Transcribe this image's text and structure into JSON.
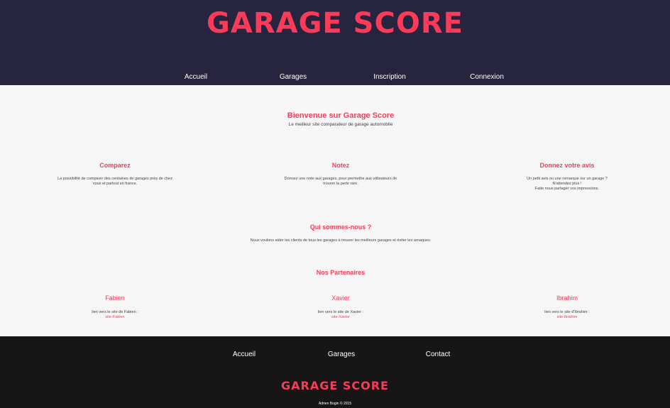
{
  "site": {
    "logo": "GARAGE SCORE"
  },
  "nav": [
    {
      "label": "Accueil"
    },
    {
      "label": "Garages"
    },
    {
      "label": "Inscription"
    },
    {
      "label": "Connexion"
    }
  ],
  "welcome": {
    "title": "Bienvenue sur Garage Score",
    "subtitle": "Le meilleur site comparateur de garage automobile"
  },
  "features": [
    {
      "title": "Comparez",
      "lines": [
        "La possibilité de comparer des centaines de garages près de chez",
        "vous et partout en france."
      ]
    },
    {
      "title": "Notez",
      "lines": [
        "Donnez une note aux garages, pour permettre aux utilisateurs de",
        "trouver la perle rare."
      ]
    },
    {
      "title": "Donnez votre avis",
      "lines": [
        "Un petit avis ou une remarque sur un garage ?",
        "N'attendez plus !",
        "Faite nous partager vos impressions."
      ]
    }
  ],
  "about": {
    "title": "Qui sommes-nous ?",
    "text": "Nous voulons aider les clients de tous les garages à trouver les meilleurs garages et éviter les arnaques."
  },
  "partners": {
    "title": "Nos Partenaires",
    "items": [
      {
        "name": "Fabien",
        "caption": "lien vers le site de Fabien :",
        "link": "site-Fabien"
      },
      {
        "name": "Xavier",
        "caption": "lien vers le site de Xavier :",
        "link": "site-Xavier"
      },
      {
        "name": "Ibrahim",
        "caption": "lien vers le site d'Ibrahim :",
        "link": "site-Ibrahim"
      }
    ]
  },
  "footer": {
    "nav": [
      {
        "label": "Accueil"
      },
      {
        "label": "Garages"
      },
      {
        "label": "Contact"
      }
    ],
    "logo": "GARAGE SCORE",
    "copyright": "Adrien Bogin © 2015"
  }
}
